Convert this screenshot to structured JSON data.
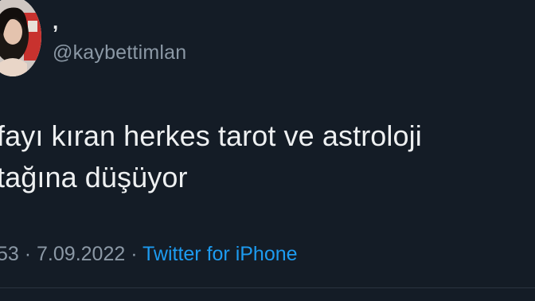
{
  "author": {
    "display_name": ",",
    "handle": "@kaybettimlan"
  },
  "tweet": {
    "lines": [
      "fayı kıran herkes tarot ve astroloji",
      "tağına düşüyor"
    ]
  },
  "meta": {
    "time_fragment": "53",
    "separator1": " · ",
    "date": "7.09.2022",
    "separator2": " · ",
    "source": "Twitter for iPhone"
  },
  "colors": {
    "background": "#141c26",
    "text": "#e7e9ea",
    "secondary": "#8b98a5",
    "accent": "#1d9bf0"
  }
}
